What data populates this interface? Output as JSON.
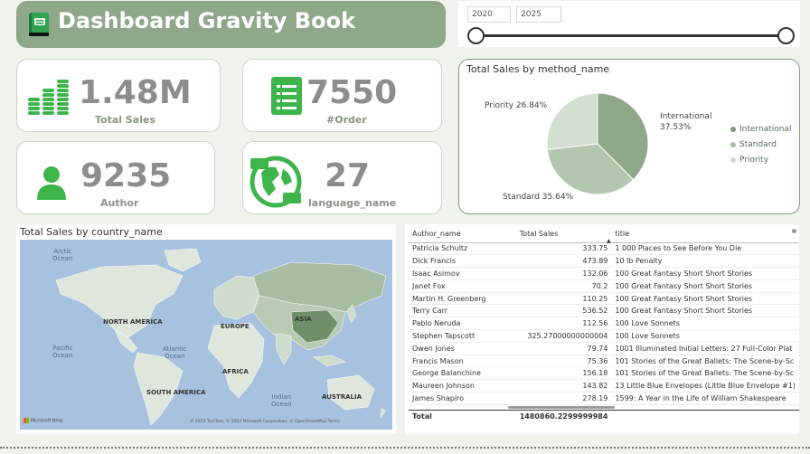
{
  "header": {
    "title": "Dashboard Gravity Book"
  },
  "slicer": {
    "start_year": "2020",
    "end_year": "2025"
  },
  "kpis": {
    "total_sales_value": "1.48M",
    "total_sales_label": "Total Sales",
    "orders_value": "7550",
    "orders_label": "#Order",
    "author_value": "9235",
    "author_label": "Author",
    "language_value": "27",
    "language_label": "language_name"
  },
  "pie": {
    "title": "Total Sales by method_name",
    "label_international_name": "International",
    "label_international_pct": "37.53%",
    "label_standard": "Standard 35.64%",
    "label_priority": "Priority 26.84%",
    "legend": [
      "International",
      "Standard",
      "Priority"
    ]
  },
  "chart_data": {
    "type": "pie",
    "title": "Total Sales by method_name",
    "categories": [
      "International",
      "Standard",
      "Priority"
    ],
    "values": [
      37.53,
      35.64,
      26.84
    ],
    "colors": [
      "#8ea889",
      "#b3c6b0",
      "#d3dfcf"
    ],
    "legend": "right"
  },
  "map": {
    "title": "Total Sales by country_name",
    "labels": {
      "arctic": "Arctic\nOcean",
      "north_america": "NORTH AMERICA",
      "europe": "EUROPE",
      "asia": "ASIA",
      "pacific": "Pacific\nOcean",
      "atlantic": "Atlantic\nOcean",
      "africa": "AFRICA",
      "south_america": "SOUTH AMERICA",
      "indian": "Indian\nOcean",
      "australia": "AUSTRALIA"
    },
    "bing": "Microsoft Bing",
    "copyright": "© 2023 TomTom, © 2023 Microsoft Corporation, © OpenStreetMap  Terms"
  },
  "table": {
    "headers": [
      "Author_name",
      "Total Sales",
      "title"
    ],
    "rows": [
      [
        "Patricia Schultz",
        "333.75",
        "1 000 Places to See Before You Die"
      ],
      [
        "Dick Francis",
        "473.89",
        "10 lb Penalty"
      ],
      [
        "Isaac Asimov",
        "132.06",
        "100 Great Fantasy Short Short Stories"
      ],
      [
        "Janet Fox",
        "70.2",
        "100 Great Fantasy Short Short Stories"
      ],
      [
        "Martin H. Greenberg",
        "110.25",
        "100 Great Fantasy Short Short Stories"
      ],
      [
        "Terry Carr",
        "536.52",
        "100 Great Fantasy Short Short Stories"
      ],
      [
        "Pablo Neruda",
        "112.56",
        "100 Love Sonnets"
      ],
      [
        "Stephen Tapscott",
        "325.27000000000004",
        "100 Love Sonnets"
      ],
      [
        "Owen Jones",
        "79.74",
        "1001 Illuminated Initial Letters: 27 Full-Color Plat"
      ],
      [
        "Francis Mason",
        "75.36",
        "101 Stories of the Great Ballets: The Scene-by-Sc"
      ],
      [
        "George Balanchine",
        "156.18",
        "101 Stories of the Great Ballets: The Scene-by-Sc"
      ],
      [
        "Maureen Johnson",
        "143.82",
        "13 Little Blue Envelopes (Little Blue Envelope #1)"
      ],
      [
        "James Shapiro",
        "278.19",
        "1599: A Year in the Life of William Shakespeare"
      ]
    ],
    "total_label": "Total",
    "total_value": "1480860.2299999984"
  }
}
